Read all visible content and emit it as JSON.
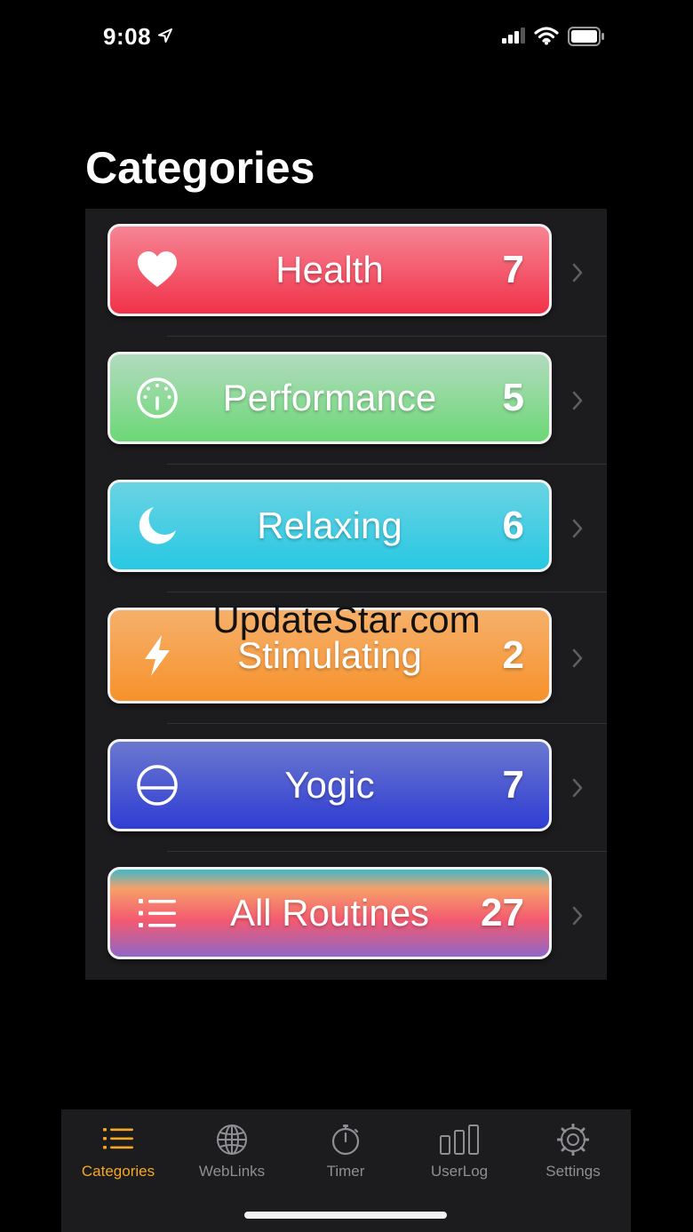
{
  "status_bar": {
    "time": "9:08"
  },
  "page": {
    "title": "Categories"
  },
  "categories": [
    {
      "label": "Health",
      "count": "7",
      "icon": "heart-icon"
    },
    {
      "label": "Performance",
      "count": "5",
      "icon": "gauge-icon"
    },
    {
      "label": "Relaxing",
      "count": "6",
      "icon": "moon-icon"
    },
    {
      "label": "Stimulating",
      "count": "2",
      "icon": "bolt-icon"
    },
    {
      "label": "Yogic",
      "count": "7",
      "icon": "circle-half-icon"
    },
    {
      "label": "All Routines",
      "count": "27",
      "icon": "list-icon"
    }
  ],
  "watermark": "UpdateStar.com",
  "tabs": [
    {
      "label": "Categories",
      "icon": "list-icon",
      "active": true
    },
    {
      "label": "WebLinks",
      "icon": "globe-icon",
      "active": false
    },
    {
      "label": "Timer",
      "icon": "stopwatch-icon",
      "active": false
    },
    {
      "label": "UserLog",
      "icon": "bar-chart-icon",
      "active": false
    },
    {
      "label": "Settings",
      "icon": "gear-icon",
      "active": false
    }
  ],
  "colors": {
    "accent": "#f5a623",
    "health": "#f13249",
    "performance": "#6cd876",
    "relaxing": "#28c8e3",
    "stimulating": "#f6922c",
    "yogic": "#2f3dd4"
  }
}
